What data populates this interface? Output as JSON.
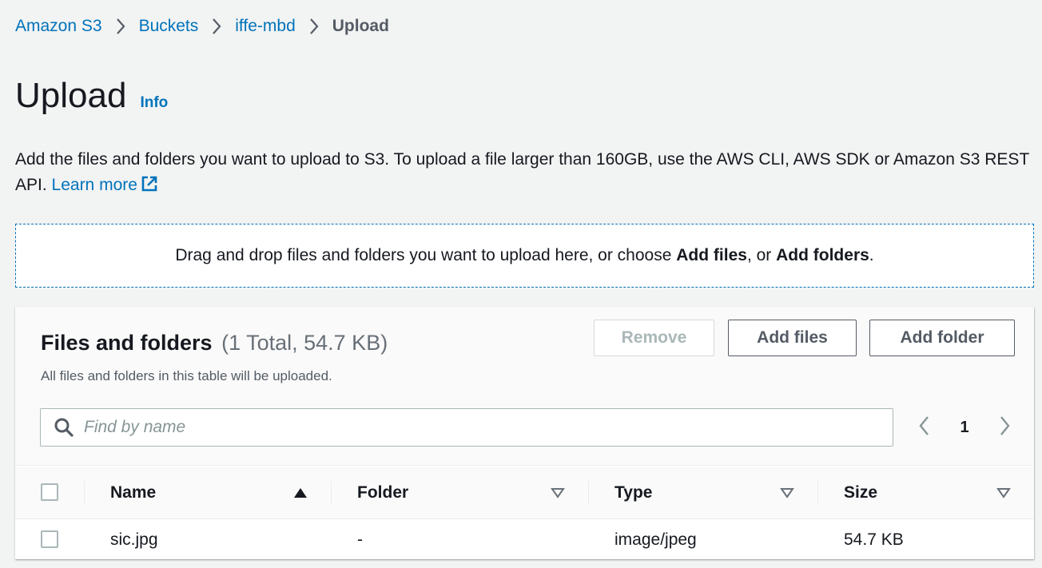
{
  "breadcrumb": {
    "items": [
      "Amazon S3",
      "Buckets",
      "iffe-mbd"
    ],
    "current": "Upload"
  },
  "page": {
    "title": "Upload",
    "info_link": "Info",
    "description": "Add the files and folders you want to upload to S3. To upload a file larger than 160GB, use the AWS CLI, AWS SDK or Amazon S3 REST API.",
    "learn_more": "Learn more"
  },
  "dropzone": {
    "text_before": "Drag and drop files and folders you want to upload here, or choose ",
    "add_files": "Add files",
    "text_middle": ", or ",
    "add_folders": "Add folders",
    "text_after": "."
  },
  "panel": {
    "title": "Files and folders",
    "count": "(1 Total, 54.7 KB)",
    "subtitle": "All files and folders in this table will be uploaded.",
    "buttons": {
      "remove": "Remove",
      "add_files": "Add files",
      "add_folder": "Add folder"
    },
    "search": {
      "placeholder": "Find by name",
      "value": ""
    },
    "pagination": {
      "current_page": "1"
    }
  },
  "table": {
    "columns": {
      "name": "Name",
      "folder": "Folder",
      "type": "Type",
      "size": "Size"
    },
    "rows": [
      {
        "name": "sic.jpg",
        "folder": "-",
        "type": "image/jpeg",
        "size": "54.7 KB"
      }
    ]
  },
  "colors": {
    "link": "#0073bb",
    "background": "#f2f3f3",
    "text": "#16191f",
    "muted_text": "#545b64",
    "disabled": "#aab7b8"
  },
  "icons": [
    "chevron-right-icon",
    "external-link-icon",
    "search-icon",
    "chevron-left-icon",
    "sort-ascending-icon",
    "sort-descending-icon"
  ]
}
